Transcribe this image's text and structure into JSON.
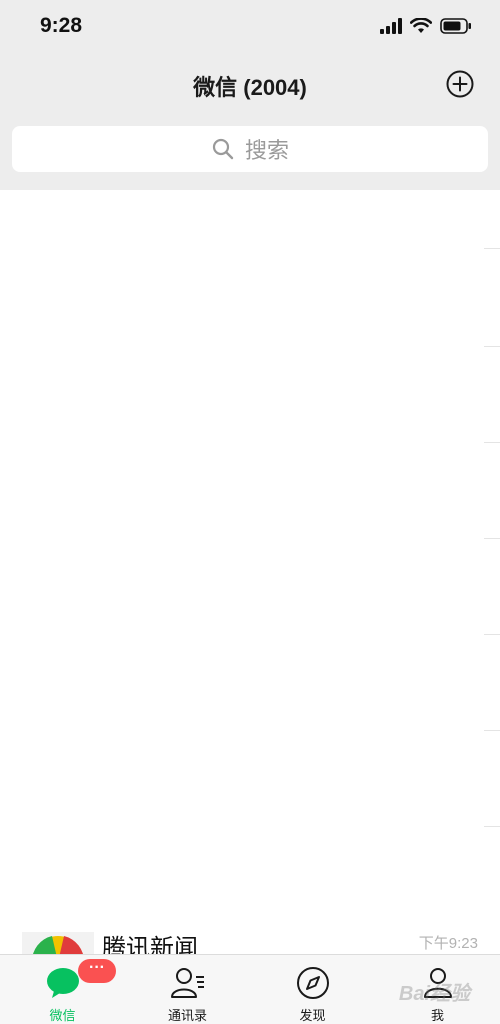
{
  "status_bar": {
    "time": "9:28",
    "signal_icon": "cellular-signal-icon",
    "wifi_icon": "wifi-icon",
    "battery_icon": "battery-icon"
  },
  "nav": {
    "title": "微信 (2004)",
    "add_icon": "plus-circle-icon"
  },
  "search": {
    "placeholder": "搜索",
    "icon": "search-icon"
  },
  "chat_list": {
    "partial_row": {
      "name": "腾讯新闻",
      "time": "下午9:23"
    }
  },
  "tabs": [
    {
      "label": "微信",
      "icon": "chat-bubble-icon",
      "active": true,
      "badge": "···"
    },
    {
      "label": "通讯录",
      "icon": "contacts-icon",
      "active": false
    },
    {
      "label": "发现",
      "icon": "compass-icon",
      "active": false
    },
    {
      "label": "我",
      "icon": "person-icon",
      "active": false
    }
  ],
  "watermark": "Bai经验",
  "colors": {
    "accent_green": "#07c160",
    "badge_red": "#fa5151",
    "header_bg": "#ededed"
  }
}
